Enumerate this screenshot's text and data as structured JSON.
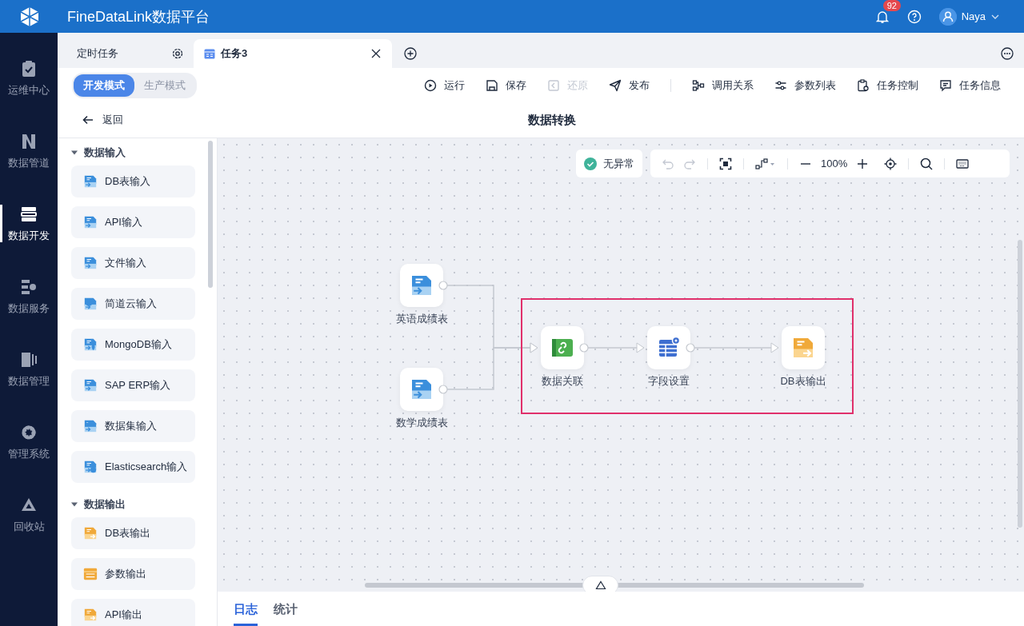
{
  "app": {
    "title": "FineDataLink数据平台",
    "notifications": "92",
    "user": "Naya"
  },
  "nav": [
    {
      "label": "运维中心",
      "kind": "clipboard",
      "selected": false
    },
    {
      "label": "数据管道",
      "kind": "pipeline",
      "selected": false
    },
    {
      "label": "数据开发",
      "kind": "server",
      "selected": true
    },
    {
      "label": "数据服务",
      "kind": "service",
      "selected": false
    },
    {
      "label": "数据管理",
      "kind": "bars",
      "selected": false
    },
    {
      "label": "管理系统",
      "kind": "gear",
      "selected": false
    },
    {
      "label": "回收站",
      "kind": "recycle",
      "selected": false
    }
  ],
  "tabs": [
    {
      "label": "定时任务",
      "kind": "folder",
      "selected": false
    },
    {
      "label": "任务3",
      "kind": "task",
      "selected": true
    }
  ],
  "modes": [
    {
      "label": "开发模式",
      "selected": true
    },
    {
      "label": "生产模式",
      "selected": false
    }
  ],
  "actions": [
    {
      "label": "运行",
      "kind": "play",
      "disabled": false
    },
    {
      "label": "保存",
      "kind": "save",
      "disabled": false
    },
    {
      "label": "还原",
      "kind": "restore",
      "disabled": true
    },
    {
      "label": "发布",
      "kind": "send",
      "disabled": false
    },
    {
      "label": "调用关系",
      "kind": "relation",
      "disabled": false
    },
    {
      "label": "参数列表",
      "kind": "sliders",
      "disabled": false
    },
    {
      "label": "任务控制",
      "kind": "control",
      "disabled": false
    },
    {
      "label": "任务信息",
      "kind": "info",
      "disabled": false
    }
  ],
  "page": {
    "back": "返回",
    "title": "数据转换"
  },
  "palette": [
    {
      "title": "数据输入",
      "expanded": true,
      "items": [
        {
          "label": "DB表输入",
          "kind": "db-in"
        },
        {
          "label": "API输入",
          "kind": "api-in"
        },
        {
          "label": "文件输入",
          "kind": "file-in"
        },
        {
          "label": "简道云输入",
          "kind": "cloud-in"
        },
        {
          "label": "MongoDB输入",
          "kind": "mongo-in"
        },
        {
          "label": "SAP ERP输入",
          "kind": "sap-in"
        },
        {
          "label": "数据集输入",
          "kind": "dataset-in"
        },
        {
          "label": "Elasticsearch输入",
          "kind": "elastic-in"
        }
      ]
    },
    {
      "title": "数据输出",
      "expanded": true,
      "items": [
        {
          "label": "DB表输出",
          "kind": "db-out"
        },
        {
          "label": "参数输出",
          "kind": "param-out"
        },
        {
          "label": "API输出",
          "kind": "api-out"
        }
      ]
    }
  ],
  "canvas": {
    "status": "无异常",
    "zoom": "100%",
    "nodes": [
      {
        "label": "英语成绩表",
        "kind": "db-in"
      },
      {
        "label": "数学成绩表",
        "kind": "db-in"
      },
      {
        "label": "数据关联",
        "kind": "join"
      },
      {
        "label": "字段设置",
        "kind": "fields"
      },
      {
        "label": "DB表输出",
        "kind": "db-out"
      }
    ]
  },
  "bottom_tabs": [
    {
      "label": "日志",
      "selected": true
    },
    {
      "label": "统计",
      "selected": false
    }
  ]
}
